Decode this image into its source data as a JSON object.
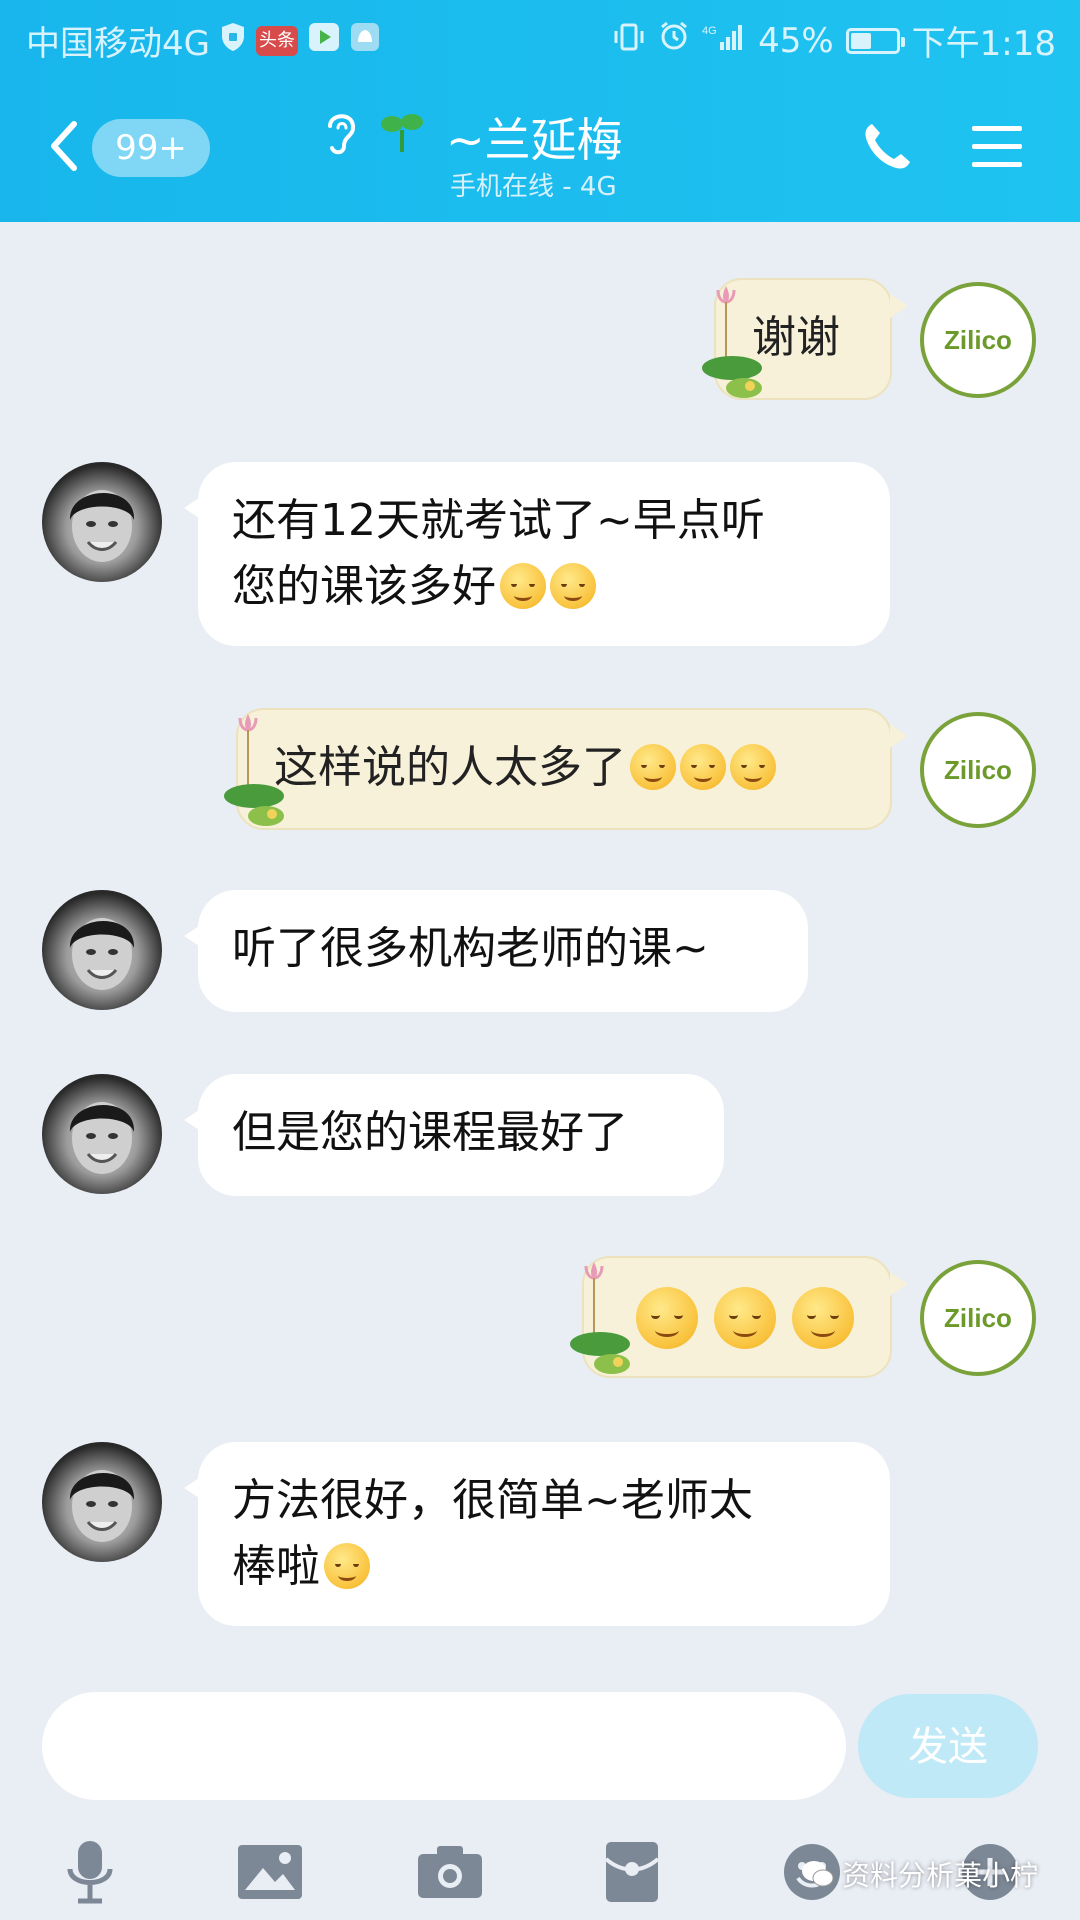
{
  "status_bar": {
    "carrier": "中国移动4G",
    "app_badge_1": "头条",
    "battery_percent": "45%",
    "battery_level": 0.45,
    "time": "下午1:18",
    "network": "4G"
  },
  "header": {
    "unread_count": "99+",
    "contact_name": "~兰延梅",
    "contact_status": "手机在线 - 4G"
  },
  "messages": [
    {
      "side": "right",
      "text": "谢谢",
      "emojis": []
    },
    {
      "side": "left",
      "line1": "还有12天就考试了~早点听",
      "line2": "您的课该多好",
      "emojis": [
        "crying-face",
        "crying-face"
      ]
    },
    {
      "side": "right",
      "text": "这样说的人太多了",
      "emojis": [
        "tears-of-joy",
        "tears-of-joy",
        "tears-of-joy"
      ]
    },
    {
      "side": "left",
      "text": "听了很多机构老师的课~"
    },
    {
      "side": "left",
      "text": "但是您的课程最好了"
    },
    {
      "side": "right",
      "text": "",
      "emojis": [
        "blushing-face",
        "blushing-face",
        "blushing-face"
      ]
    },
    {
      "side": "left",
      "line1": "方法很好，很简单~老师太",
      "line2": "棒啦",
      "emojis": [
        "grinning-face"
      ]
    }
  ],
  "my_avatar_text": "Zilico",
  "composer": {
    "input_value": "",
    "send_label": "发送"
  },
  "watermark": "资料分析菓小柠",
  "colors": {
    "header_bg": "#1fbdef",
    "chat_bg": "#e9edf4",
    "my_bubble": "#f7f1d9",
    "their_bubble": "#ffffff",
    "send_button": "#bfe9f7",
    "avatar_ring": "#7aa23a"
  }
}
